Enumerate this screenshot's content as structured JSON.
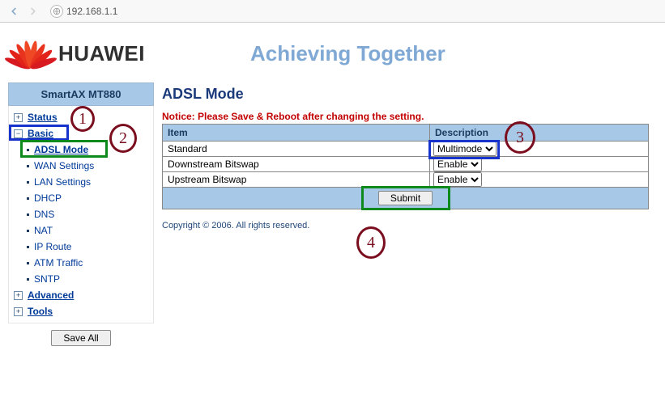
{
  "browser": {
    "address": "192.168.1.1"
  },
  "header": {
    "brand": "HUAWEI",
    "tagline": "Achieving Together"
  },
  "sidebar": {
    "device": "SmartAX MT880",
    "sections": {
      "status": {
        "label": "Status",
        "expanded": false
      },
      "basic": {
        "label": "Basic",
        "expanded": true,
        "items": [
          {
            "label": "ADSL Mode",
            "active": true
          },
          {
            "label": "WAN Settings"
          },
          {
            "label": "LAN Settings"
          },
          {
            "label": "DHCP"
          },
          {
            "label": "DNS"
          },
          {
            "label": "NAT"
          },
          {
            "label": "IP Route"
          },
          {
            "label": "ATM Traffic"
          },
          {
            "label": "SNTP"
          }
        ]
      },
      "advanced": {
        "label": "Advanced",
        "expanded": false
      },
      "tools": {
        "label": "Tools",
        "expanded": false
      }
    },
    "save_all_label": "Save All"
  },
  "main": {
    "title": "ADSL Mode",
    "notice": "Notice: Please Save & Reboot after changing the setting.",
    "columns": {
      "item": "Item",
      "description": "Description"
    },
    "rows": [
      {
        "item": "Standard",
        "value": "Multimode",
        "options": [
          "Multimode"
        ]
      },
      {
        "item": "Downstream Bitswap",
        "value": "Enable",
        "options": [
          "Enable"
        ]
      },
      {
        "item": "Upstream Bitswap",
        "value": "Enable",
        "options": [
          "Enable"
        ]
      }
    ],
    "submit_label": "Submit",
    "copyright": "Copyright © 2006. All rights reserved."
  },
  "annotations": {
    "n1": "1",
    "n2": "2",
    "n3": "3",
    "n4": "4"
  }
}
